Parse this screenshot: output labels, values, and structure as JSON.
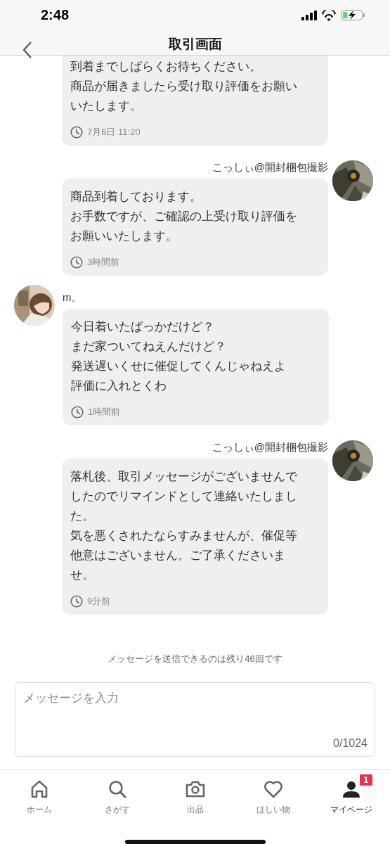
{
  "status_bar": {
    "time": "2:48"
  },
  "header": {
    "title": "取引画面"
  },
  "messages": [
    {
      "kind": "continued",
      "lines": [
        "到着までしばらくお待ちください。",
        "商品が届きましたら受け取り評価をお願い",
        "いたします。"
      ],
      "time": "7月6日 11:20"
    },
    {
      "kind": "outgoing",
      "sender": "こっしぃ@開封梱包撮影",
      "lines": [
        "商品到着しております。",
        "お手数ですが、ご確認の上受け取り評価を",
        "お願いいたします。"
      ],
      "time": "3時間前"
    },
    {
      "kind": "incoming",
      "sender": "m。",
      "lines": [
        "今日着いたばっかだけど？",
        "まだ家ついてねえんだけど？",
        "発送遅いくせに催促してくんじゃねえよ",
        "評価に入れとくわ"
      ],
      "time": "1時間前"
    },
    {
      "kind": "outgoing",
      "sender": "こっしぃ@開封梱包撮影",
      "lines": [
        "落札後、取引メッセージがございませんで",
        "したのでリマインドとして連絡いたしまし",
        "た。",
        "気を悪くされたならすみませんが、催促等",
        "他意はございません。ご了承くださいま",
        "せ。"
      ],
      "time": "9分前"
    }
  ],
  "notice": "メッセージを送信できるのは残り46回です",
  "input": {
    "placeholder": "メッセージを入力",
    "counter": "0/1024"
  },
  "tabs": [
    {
      "kind": "home",
      "label": "ホーム",
      "selected": false
    },
    {
      "kind": "search",
      "label": "さがす",
      "selected": false
    },
    {
      "kind": "camera",
      "label": "出品",
      "selected": false
    },
    {
      "kind": "heart",
      "label": "ほしい物",
      "selected": false
    },
    {
      "kind": "person",
      "label": "マイページ",
      "selected": true,
      "badge": "1"
    }
  ]
}
